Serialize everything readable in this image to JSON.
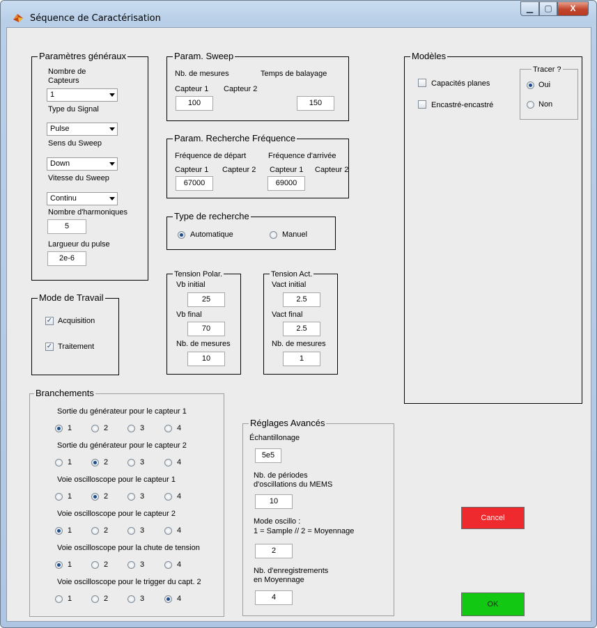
{
  "window": {
    "title": "Séquence de Caractérisation",
    "min_icon": "minimize-icon",
    "max_icon": "maximize-icon",
    "close_icon": "close-icon",
    "close_glyph": "X"
  },
  "general": {
    "title": "Paramètres généraux",
    "nb_capteurs_label_1": "Nombre de",
    "nb_capteurs_label_2": "Capteurs",
    "nb_capteurs_value": "1",
    "signal_label": "Type du Signal",
    "signal_value": "Pulse",
    "sens_label": "Sens du Sweep",
    "sens_value": "Down",
    "vitesse_label": "Vitesse du Sweep",
    "vitesse_value": "Continu",
    "harmoniques_label": "Nombre d'harmoniques",
    "harmoniques_value": "5",
    "largeur_label": "Largueur du pulse",
    "largeur_value": "2e-6"
  },
  "sweep": {
    "title": "Param. Sweep",
    "nb_mesures": "Nb. de mesures",
    "temps": "Temps de balayage",
    "capteur1": "Capteur 1",
    "capteur2": "Capteur 2",
    "nb_value": "100",
    "temps_value": "150"
  },
  "freq": {
    "title": "Param. Recherche Fréquence",
    "depart": "Fréquence de départ",
    "arrivee": "Fréquence d'arrivée",
    "capteur1": "Capteur 1",
    "capteur2": "Capteur 2",
    "depart_value": "67000",
    "arrivee_value": "69000"
  },
  "recherche": {
    "title": "Type de recherche",
    "auto": "Automatique",
    "manuel": "Manuel"
  },
  "polar": {
    "title": "Tension Polar.",
    "vb_initial": "Vb initial",
    "vb_initial_value": "25",
    "vb_final": "Vb final",
    "vb_final_value": "70",
    "nb_mesures": "Nb. de mesures",
    "nb_value": "10"
  },
  "act": {
    "title": "Tension Act.",
    "initial": "Vact initial",
    "initial_value": "2.5",
    "final": "Vact final",
    "final_value": "2.5",
    "nb_mesures": "Nb. de mesures",
    "nb_value": "1"
  },
  "mode": {
    "title": "Mode de Travail",
    "acquisition": "Acquisition",
    "traitement": "Traitement",
    "check_glyph": "✓"
  },
  "modeles": {
    "title": "Modèles",
    "capacites": "Capacités planes",
    "encastre": "Encastré-encastré",
    "tracer_title": "Tracer ?",
    "oui": "Oui",
    "non": "Non"
  },
  "branchements": {
    "title": "Branchements",
    "rows": [
      {
        "label": "Sortie du générateur pour le capteur 1",
        "selected": 1
      },
      {
        "label": "Sortie du générateur pour le capteur 2",
        "selected": 2
      },
      {
        "label": "Voie oscilloscope pour le capteur 1",
        "selected": 2
      },
      {
        "label": "Voie oscilloscope pour le capteur 2",
        "selected": 1
      },
      {
        "label": "Voie oscilloscope pour la chute de tension",
        "selected": 1
      },
      {
        "label": "Voie oscilloscope pour le trigger du capt. 2",
        "selected": 4
      }
    ],
    "options": [
      "1",
      "2",
      "3",
      "4"
    ]
  },
  "avances": {
    "title": "Réglages Avancés",
    "echantillonage": "Échantillonage",
    "echantillonage_value": "5e5",
    "periodes_1": "Nb. de périodes",
    "periodes_2": "d'oscillations du MEMS",
    "periodes_value": "10",
    "mode_1": "Mode oscillo :",
    "mode_2": "1 = Sample // 2 = Moyennage",
    "mode_value": "2",
    "enreg_1": "Nb. d'enregistrements",
    "enreg_2": "en Moyennage",
    "enreg_value": "4"
  },
  "buttons": {
    "cancel": "Cancel",
    "ok": "OK"
  }
}
